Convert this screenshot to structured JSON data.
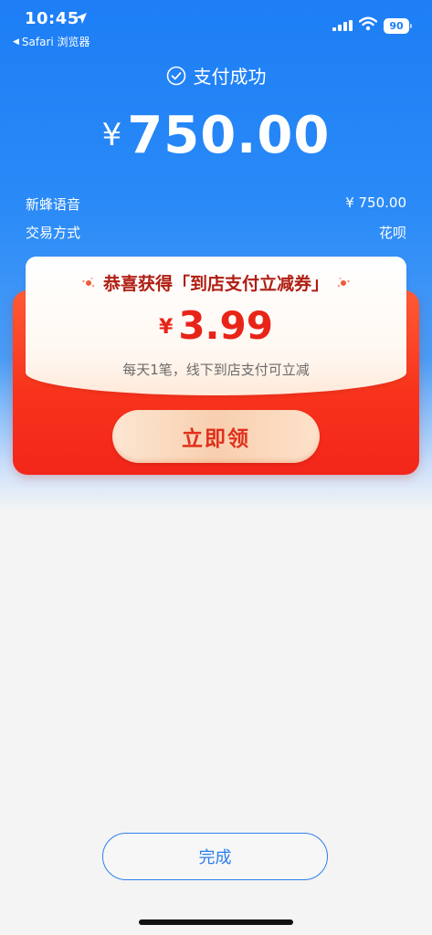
{
  "status_bar": {
    "time": "10:45",
    "back_app_label": "Safari 浏览器",
    "battery": "90"
  },
  "payment": {
    "status_text": "支付成功",
    "currency_symbol": "¥",
    "amount": "750.00",
    "details": [
      {
        "label": "新蜂语音",
        "value": "¥ 750.00"
      },
      {
        "label": "交易方式",
        "value": "花呗"
      }
    ]
  },
  "coupon": {
    "title": "恭喜获得「到店支付立减券」",
    "currency_symbol": "¥",
    "amount": "3.99",
    "description": "每天1笔，线下到店支付可立减",
    "claim_label": "立即领"
  },
  "footer": {
    "done_label": "完成"
  },
  "colors": {
    "primary_blue": "#1d7ef6",
    "coupon_red": "#f8331c",
    "button_blue": "#2b7ff0"
  },
  "icons": {
    "location": "location-arrow-icon",
    "signal": "cellular-signal-icon",
    "wifi": "wifi-icon",
    "success": "check-circle-icon",
    "decoration": "confetti-icon"
  }
}
